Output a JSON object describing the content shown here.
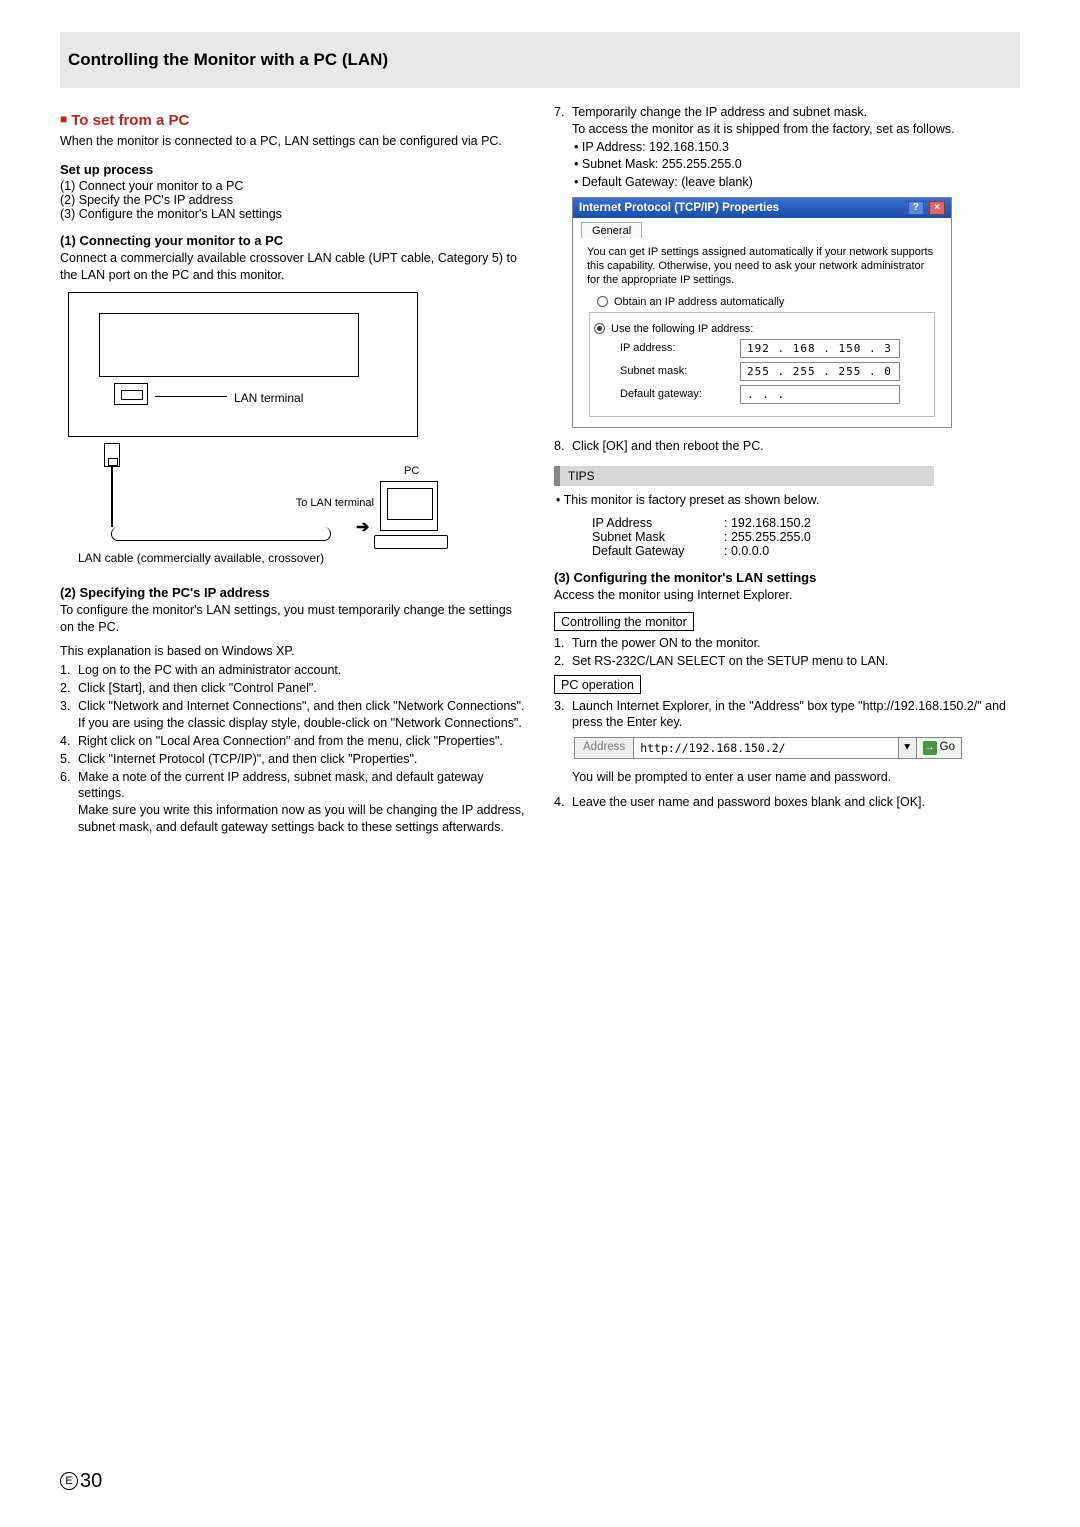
{
  "banner": {
    "title": "Controlling the Monitor with a PC (LAN)"
  },
  "left": {
    "lead": "To set from a PC",
    "intro": "When the monitor is connected to a PC, LAN settings can be configured via PC.",
    "setup_h": "Set up process",
    "setup": [
      "(1) Connect your monitor to a PC",
      "(2) Specify the PC's IP address",
      "(3) Configure the monitor's LAN settings"
    ],
    "s1_h": "(1) Connecting your monitor to a PC",
    "s1_p": "Connect a commercially available crossover LAN cable (UPT cable, Category 5) to the LAN  port on the PC and this monitor.",
    "diag": {
      "lan_terminal": "LAN terminal",
      "pc": "PC",
      "to_lan": "To LAN terminal",
      "caption": "LAN cable (commercially available, crossover)"
    },
    "s2_h": "(2) Specifying the PC's IP address",
    "s2_p1": "To configure the monitor's LAN settings, you must temporarily change the settings on the PC.",
    "s2_p2": "This explanation is based on Windows XP.",
    "s2_list": [
      "Log on to the PC with an administrator account.",
      "Click [Start], and then click \"Control Panel\".",
      "Click \"Network and Internet Connections\", and then click \"Network Connections\".\nIf you are using the classic display style, double-click on \"Network Connections\".",
      "Right click on \"Local Area Connection\" and from the menu, click \"Properties\".",
      "Click \"Internet Protocol (TCP/IP)\", and then click \"Properties\".",
      "Make a note of the current IP address, subnet mask, and default gateway settings.\nMake sure you write this information now as you will be changing the IP address, subnet mask, and default gateway settings back to these settings afterwards."
    ]
  },
  "right": {
    "step7": {
      "lead": "Temporarily change the IP address and subnet mask.",
      "body": "To access the monitor as it is shipped from the factory, set as follows.",
      "bullets": [
        "IP Address: 192.168.150.3",
        "Subnet Mask: 255.255.255.0",
        "Default Gateway: (leave blank)"
      ]
    },
    "win": {
      "title": "Internet Protocol (TCP/IP) Properties",
      "tab": "General",
      "desc": "You can get IP settings assigned automatically if your network supports this capability. Otherwise, you need to ask your network administrator for the appropriate IP settings.",
      "r_auto": "Obtain an IP address automatically",
      "r_use": "Use the following IP address:",
      "f_ip_l": "IP address:",
      "f_ip_v": "192 . 168 . 150 .   3",
      "f_sm_l": "Subnet mask:",
      "f_sm_v": "255 . 255 . 255 .   0",
      "f_gw_l": "Default gateway:",
      "f_gw_v": ".       .       ."
    },
    "step8": "Click [OK] and then reboot the PC.",
    "tips_label": "TIPS",
    "tips_line": "This monitor is factory preset as shown below.",
    "tips_kv": [
      {
        "k": "IP Address",
        "v": ": 192.168.150.2"
      },
      {
        "k": "Subnet Mask",
        "v": ": 255.255.255.0"
      },
      {
        "k": "Default Gateway",
        "v": ": 0.0.0.0"
      }
    ],
    "s3_h": "(3) Configuring the monitor's LAN settings",
    "s3_p": "Access the monitor using Internet Explorer.",
    "box_ctrl": "Controlling the monitor",
    "ctrl_list": [
      "Turn the power ON to the monitor.",
      "Set RS-232C/LAN SELECT on the SETUP menu to LAN."
    ],
    "box_pc": "PC operation",
    "pc_step3": "Launch Internet Explorer, in the \"Address\" box type \"http://192.168.150.2/\" and press the Enter key.",
    "addr": {
      "label": "Address",
      "value": "http://192.168.150.2/",
      "go": "Go"
    },
    "after_addr": "You will be prompted to enter a user name and password.",
    "pc_step4": "Leave the user name and password boxes blank and click [OK]."
  },
  "footer": {
    "mark": "E",
    "page": "30"
  }
}
